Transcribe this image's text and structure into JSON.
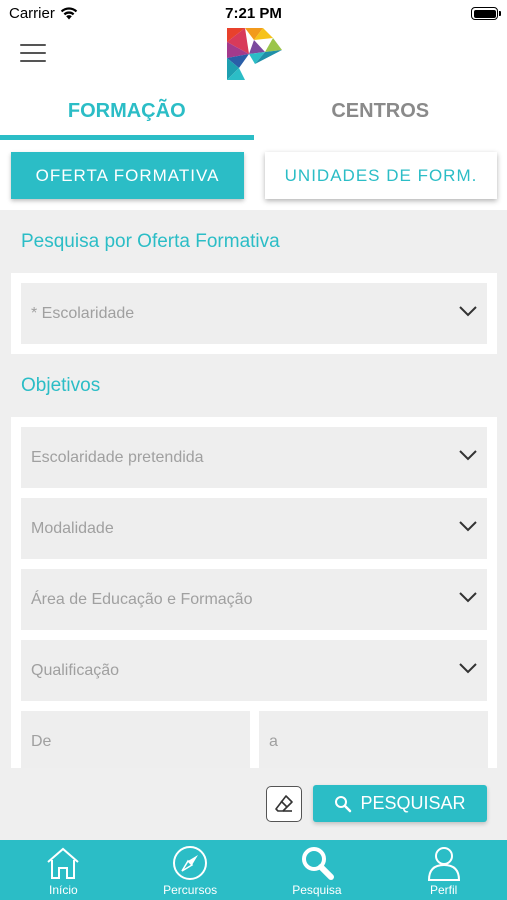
{
  "status_bar": {
    "carrier": "Carrier",
    "time": "7:21 PM"
  },
  "tabs": [
    {
      "label": "FORMAÇÃO",
      "active": true
    },
    {
      "label": "CENTROS",
      "active": false
    }
  ],
  "sub_buttons": [
    {
      "label": "OFERTA FORMATIVA",
      "active": true
    },
    {
      "label": "UNIDADES DE FORM.",
      "active": false
    }
  ],
  "search_section": {
    "title": "Pesquisa por Oferta Formativa",
    "escolaridade_placeholder": "* Escolaridade"
  },
  "objetivos_section": {
    "title": "Objetivos",
    "fields": [
      {
        "placeholder": "Escolaridade pretendida"
      },
      {
        "placeholder": "Modalidade"
      },
      {
        "placeholder": "Área de Educação e Formação"
      },
      {
        "placeholder": "Qualificação"
      }
    ],
    "from_placeholder": "De",
    "to_placeholder": "a"
  },
  "actions": {
    "search_label": "PESQUISAR"
  },
  "bottom_nav": [
    {
      "label": "Início"
    },
    {
      "label": "Percursos"
    },
    {
      "label": "Pesquisa"
    },
    {
      "label": "Perfil"
    }
  ],
  "colors": {
    "accent": "#2bbdc6",
    "placeholder": "#a0a0a0",
    "inactive_tab": "#8a8a8a"
  }
}
